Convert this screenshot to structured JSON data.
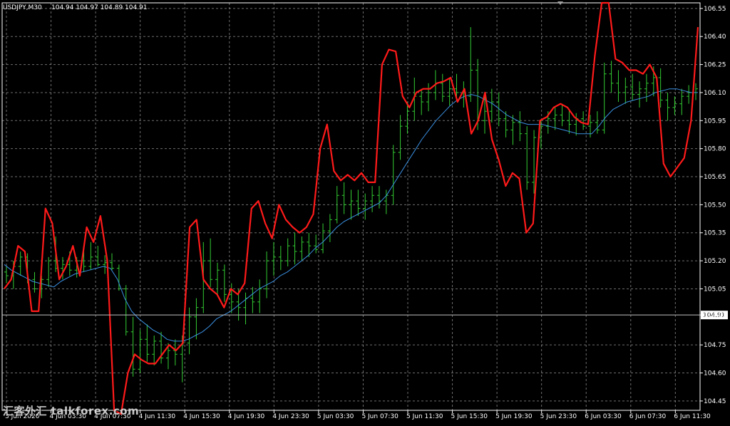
{
  "header": {
    "symbol": "USDJPY,M30",
    "ohlc": "104.94 104.97 104.89 104.91"
  },
  "price_marker": "104.91",
  "watermark": "汇客外汇 talkforex.com",
  "colors": {
    "background": "#000000",
    "grid": "#c8c8c8",
    "bars": "#33cc33",
    "red_line": "#ff1a1a",
    "blue_line": "#3a8fe0",
    "text": "#ffffff"
  },
  "chart_data": {
    "type": "line",
    "grid": true,
    "ylim": [
      104.4,
      106.58
    ],
    "y_ticks": [
      "106.55",
      "106.40",
      "106.25",
      "106.10",
      "105.95",
      "105.80",
      "105.65",
      "105.50",
      "105.35",
      "105.20",
      "105.05",
      "104.91",
      "104.75",
      "104.60",
      "104.45"
    ],
    "x_ticks": [
      "3 Jun 2020",
      "4 Jun 03:30",
      "4 Jun 07:30",
      "4 Jun 11:30",
      "4 Jun 15:30",
      "4 Jun 19:30",
      "4 Jun 23:30",
      "5 Jun 03:30",
      "5 Jun 07:30",
      "5 Jun 11:30",
      "5 Jun 15:30",
      "5 Jun 19:30",
      "5 Jun 23:30",
      "6 Jun 03:30",
      "6 Jun 07:30",
      "6 Jun 11:30"
    ],
    "current_price": 104.91,
    "bars": [
      [
        105.14,
        105.17,
        105.08,
        105.12
      ],
      [
        105.12,
        105.2,
        105.05,
        105.17
      ],
      [
        105.17,
        105.25,
        105.12,
        105.22
      ],
      [
        105.22,
        105.24,
        105.08,
        105.1
      ],
      [
        105.1,
        105.14,
        105.03,
        105.05
      ],
      [
        105.05,
        105.12,
        105.0,
        105.1
      ],
      [
        105.1,
        105.22,
        105.06,
        105.2
      ],
      [
        105.2,
        105.33,
        105.14,
        105.16
      ],
      [
        105.16,
        105.22,
        105.1,
        105.18
      ],
      [
        105.18,
        105.25,
        105.12,
        105.15
      ],
      [
        105.15,
        105.22,
        105.11,
        105.2
      ],
      [
        105.2,
        105.26,
        105.14,
        105.17
      ],
      [
        105.17,
        105.3,
        105.15,
        105.22
      ],
      [
        105.22,
        105.28,
        105.17,
        105.18
      ],
      [
        105.18,
        105.23,
        105.13,
        105.19
      ],
      [
        105.19,
        105.24,
        105.15,
        105.16
      ],
      [
        105.16,
        105.18,
        105.04,
        105.05
      ],
      [
        105.05,
        105.07,
        104.8,
        104.82
      ],
      [
        104.82,
        104.9,
        104.58,
        104.62
      ],
      [
        104.62,
        104.83,
        104.6,
        104.78
      ],
      [
        104.78,
        104.86,
        104.66,
        104.7
      ],
      [
        104.7,
        104.8,
        104.64,
        104.77
      ],
      [
        104.77,
        104.82,
        104.65,
        104.68
      ],
      [
        104.68,
        104.76,
        104.62,
        104.72
      ],
      [
        104.72,
        104.78,
        104.64,
        104.7
      ],
      [
        104.7,
        104.8,
        104.55,
        104.76
      ],
      [
        104.76,
        104.95,
        104.7,
        104.9
      ],
      [
        104.9,
        105.0,
        104.78,
        104.95
      ],
      [
        104.95,
        105.3,
        104.92,
        105.2
      ],
      [
        105.2,
        105.32,
        105.06,
        105.1
      ],
      [
        105.1,
        105.19,
        105.02,
        105.15
      ],
      [
        105.15,
        105.18,
        104.98,
        105.02
      ],
      [
        105.02,
        105.08,
        104.92,
        104.98
      ],
      [
        104.98,
        105.05,
        104.88,
        104.95
      ],
      [
        104.95,
        105.03,
        104.86,
        105.0
      ],
      [
        105.0,
        105.06,
        104.92,
        104.98
      ],
      [
        104.98,
        105.1,
        104.92,
        105.05
      ],
      [
        105.05,
        105.25,
        105.0,
        105.2
      ],
      [
        105.2,
        105.3,
        105.12,
        105.22
      ],
      [
        105.22,
        105.28,
        105.15,
        105.2
      ],
      [
        105.2,
        105.32,
        105.17,
        105.28
      ],
      [
        105.28,
        105.35,
        105.18,
        105.25
      ],
      [
        105.25,
        105.33,
        105.2,
        105.3
      ],
      [
        105.3,
        105.35,
        105.22,
        105.28
      ],
      [
        105.28,
        105.34,
        105.24,
        105.26
      ],
      [
        105.26,
        105.4,
        105.24,
        105.36
      ],
      [
        105.36,
        105.45,
        105.3,
        105.42
      ],
      [
        105.42,
        105.6,
        105.4,
        105.55
      ],
      [
        105.55,
        105.62,
        105.45,
        105.5
      ],
      [
        105.5,
        105.58,
        105.42,
        105.52
      ],
      [
        105.52,
        105.58,
        105.44,
        105.48
      ],
      [
        105.48,
        105.56,
        105.42,
        105.52
      ],
      [
        105.52,
        105.6,
        105.46,
        105.55
      ],
      [
        105.55,
        105.6,
        105.48,
        105.52
      ],
      [
        105.52,
        105.58,
        105.45,
        105.55
      ],
      [
        105.55,
        105.82,
        105.5,
        105.78
      ],
      [
        105.78,
        105.98,
        105.74,
        105.92
      ],
      [
        105.92,
        106.05,
        105.88,
        106.0
      ],
      [
        106.0,
        106.18,
        105.95,
        106.08
      ],
      [
        106.08,
        106.12,
        105.98,
        106.05
      ],
      [
        106.05,
        106.15,
        106.0,
        106.1
      ],
      [
        106.1,
        106.22,
        106.06,
        106.15
      ],
      [
        106.15,
        106.2,
        106.05,
        106.08
      ],
      [
        106.08,
        106.18,
        106.03,
        106.12
      ],
      [
        106.12,
        106.2,
        106.06,
        106.1
      ],
      [
        106.1,
        106.16,
        106.02,
        106.08
      ],
      [
        106.08,
        106.45,
        106.05,
        106.22
      ],
      [
        106.22,
        106.28,
        105.9,
        105.95
      ],
      [
        105.95,
        106.08,
        105.88,
        106.0
      ],
      [
        106.0,
        106.12,
        105.94,
        106.05
      ],
      [
        106.05,
        106.1,
        105.92,
        105.96
      ],
      [
        105.96,
        106.0,
        105.86,
        105.9
      ],
      [
        105.9,
        105.98,
        105.82,
        105.94
      ],
      [
        105.94,
        106.0,
        105.84,
        105.88
      ],
      [
        105.88,
        105.92,
        105.58,
        105.62
      ],
      [
        105.62,
        105.9,
        105.56,
        105.86
      ],
      [
        105.86,
        105.95,
        105.8,
        105.92
      ],
      [
        105.92,
        106.0,
        105.88,
        105.96
      ],
      [
        105.96,
        106.02,
        105.9,
        105.98
      ],
      [
        105.98,
        106.04,
        105.92,
        105.95
      ],
      [
        105.95,
        106.0,
        105.88,
        105.93
      ],
      [
        105.93,
        105.99,
        105.87,
        105.96
      ],
      [
        105.96,
        106.0,
        105.9,
        105.92
      ],
      [
        105.92,
        105.98,
        105.86,
        105.94
      ],
      [
        105.94,
        106.0,
        105.88,
        105.9
      ],
      [
        105.9,
        106.26,
        105.88,
        106.2
      ],
      [
        106.2,
        106.27,
        106.1,
        106.15
      ],
      [
        106.15,
        106.22,
        106.05,
        106.1
      ],
      [
        106.1,
        106.18,
        106.04,
        106.13
      ],
      [
        106.13,
        106.2,
        106.06,
        106.09
      ],
      [
        106.09,
        106.16,
        106.02,
        106.12
      ],
      [
        106.12,
        106.2,
        106.05,
        106.15
      ],
      [
        106.15,
        106.24,
        106.08,
        106.18
      ],
      [
        106.18,
        106.23,
        106.02,
        106.06
      ],
      [
        106.06,
        106.1,
        105.95,
        106.02
      ],
      [
        106.02,
        106.08,
        105.98,
        106.04
      ],
      [
        106.04,
        106.12,
        105.98,
        106.08
      ],
      [
        106.08,
        106.14,
        106.04,
        106.1
      ],
      [
        106.1,
        106.15,
        106.06,
        106.12
      ]
    ],
    "red_line": [
      105.05,
      105.1,
      105.28,
      105.25,
      104.93,
      104.93,
      105.48,
      105.4,
      105.1,
      105.17,
      105.28,
      105.12,
      105.38,
      105.3,
      105.44,
      105.2,
      104.4,
      104.38,
      104.6,
      104.7,
      104.67,
      104.65,
      104.65,
      104.7,
      104.75,
      104.72,
      104.76,
      105.38,
      105.42,
      105.1,
      105.05,
      105.02,
      104.95,
      105.05,
      105.02,
      105.08,
      105.48,
      105.52,
      105.4,
      105.32,
      105.5,
      105.42,
      105.38,
      105.35,
      105.38,
      105.45,
      105.8,
      105.93,
      105.68,
      105.63,
      105.66,
      105.63,
      105.67,
      105.62,
      105.62,
      106.25,
      106.33,
      106.32,
      106.08,
      106.02,
      106.1,
      106.12,
      106.12,
      106.15,
      106.16,
      106.18,
      106.05,
      106.12,
      105.88,
      105.95,
      106.1,
      105.85,
      105.74,
      105.6,
      105.67,
      105.64,
      105.35,
      105.4,
      105.95,
      105.97,
      106.02,
      106.04,
      106.02,
      105.97,
      105.94,
      105.93,
      106.3,
      106.58,
      106.58,
      106.28,
      106.26,
      106.22,
      106.22,
      106.2,
      106.25,
      106.18,
      105.72,
      105.65,
      105.7,
      105.75,
      105.95,
      106.45
    ],
    "blue_line": [
      105.18,
      105.15,
      105.13,
      105.11,
      105.09,
      105.08,
      105.07,
      105.06,
      105.09,
      105.11,
      105.13,
      105.14,
      105.15,
      105.16,
      105.17,
      105.16,
      105.1,
      105.0,
      104.93,
      104.89,
      104.86,
      104.83,
      104.81,
      104.78,
      104.77,
      104.77,
      104.78,
      104.8,
      104.82,
      104.85,
      104.89,
      104.91,
      104.93,
      104.96,
      104.99,
      105.02,
      105.05,
      105.07,
      105.09,
      105.12,
      105.14,
      105.17,
      105.2,
      105.23,
      105.27,
      105.3,
      105.34,
      105.38,
      105.41,
      105.43,
      105.45,
      105.47,
      105.49,
      105.51,
      105.55,
      105.61,
      105.67,
      105.73,
      105.79,
      105.85,
      105.9,
      105.95,
      105.99,
      106.03,
      106.06,
      106.08,
      106.09,
      106.08,
      106.06,
      106.04,
      106.01,
      105.98,
      105.96,
      105.94,
      105.93,
      105.93,
      105.93,
      105.92,
      105.91,
      105.9,
      105.89,
      105.88,
      105.88,
      105.88,
      105.92,
      105.97,
      106.01,
      106.03,
      106.05,
      106.06,
      106.07,
      106.08,
      106.1,
      106.11,
      106.12,
      106.12,
      106.11,
      106.1,
      106.1
    ]
  }
}
